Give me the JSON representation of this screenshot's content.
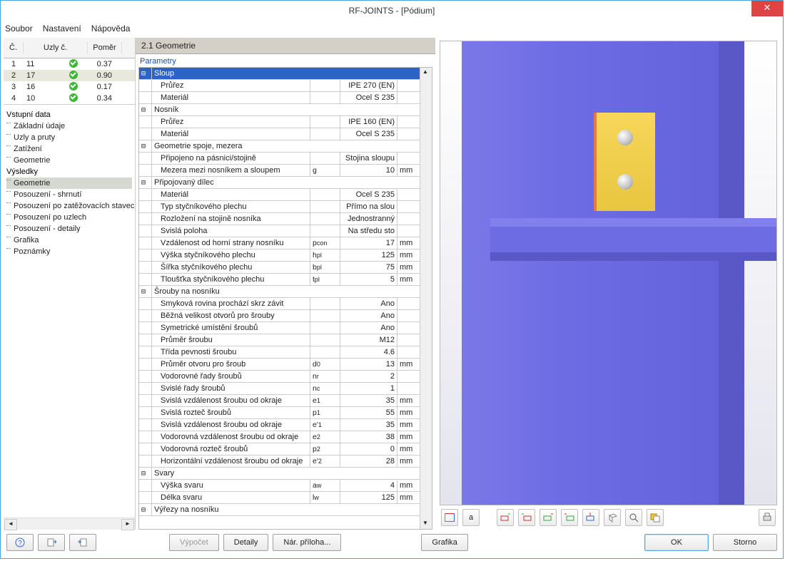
{
  "title": "RF-JOINTS - [Pódium]",
  "menus": [
    "Soubor",
    "Nastavení",
    "Nápověda"
  ],
  "nodelist": {
    "headers": [
      "Č.",
      "Uzly č.",
      "Poměr"
    ],
    "rows": [
      {
        "idx": "1",
        "node": "11",
        "ratio": "0.37",
        "sel": false
      },
      {
        "idx": "2",
        "node": "17",
        "ratio": "0.90",
        "sel": true
      },
      {
        "idx": "3",
        "node": "16",
        "ratio": "0.17",
        "sel": false
      },
      {
        "idx": "4",
        "node": "10",
        "ratio": "0.34",
        "sel": false
      }
    ]
  },
  "tree": {
    "input_hdr": "Vstupní data",
    "input": [
      "Základní údaje",
      "Uzly a pruty",
      "Zatížení",
      "Geometrie"
    ],
    "results_hdr": "Výsledky",
    "results": [
      "Geometrie",
      "Posouzení - shrnutí",
      "Posouzení po zatěžovacích stavech",
      "Posouzení po uzlech",
      "Posouzení - detaily",
      "Grafika",
      "Poznámky"
    ]
  },
  "section": {
    "title": "2.1 Geometrie",
    "param_label": "Parametry"
  },
  "params": [
    {
      "type": "group",
      "label": "Sloup",
      "sel": true
    },
    {
      "type": "row",
      "label": "Průřez",
      "sym": "",
      "val": "IPE 270 (EN)",
      "unit": ""
    },
    {
      "type": "row",
      "label": "Materiál",
      "sym": "",
      "val": "Ocel S 235",
      "unit": ""
    },
    {
      "type": "group",
      "label": "Nosník"
    },
    {
      "type": "row",
      "label": "Průřez",
      "sym": "",
      "val": "IPE 160 (EN)",
      "unit": ""
    },
    {
      "type": "row",
      "label": "Materiál",
      "sym": "",
      "val": "Ocel S 235",
      "unit": ""
    },
    {
      "type": "group",
      "label": "Geometrie spoje, mezera"
    },
    {
      "type": "row",
      "label": "Připojeno na pásnici/stojině",
      "sym": "",
      "val": "Stojina sloupu",
      "unit": ""
    },
    {
      "type": "row",
      "label": "Mezera mezi nosníkem a sloupem",
      "sym": "g",
      "val": "10",
      "unit": "mm"
    },
    {
      "type": "group",
      "label": "Připojovaný dílec"
    },
    {
      "type": "row",
      "label": "Materiál",
      "sym": "",
      "val": "Ocel S 235",
      "unit": ""
    },
    {
      "type": "row",
      "label": "Typ styčníkového plechu",
      "sym": "",
      "val": "Přímo na slou",
      "unit": ""
    },
    {
      "type": "row",
      "label": "Rozložení na stojině nosníka",
      "sym": "",
      "val": "Jednostranný",
      "unit": ""
    },
    {
      "type": "row",
      "label": "Svislá poloha",
      "sym": "",
      "val": "Na středu sto",
      "unit": ""
    },
    {
      "type": "row",
      "label": "Vzdálenost od horní strany nosníku",
      "sym": "p con",
      "val": "17",
      "unit": "mm"
    },
    {
      "type": "row",
      "label": "Výška styčníkového plechu",
      "sym": "h pl",
      "val": "125",
      "unit": "mm"
    },
    {
      "type": "row",
      "label": "Šířka styčníkového plechu",
      "sym": "b pl",
      "val": "75",
      "unit": "mm"
    },
    {
      "type": "row",
      "label": "Tloušťka styčníkového plechu",
      "sym": "t pl",
      "val": "5",
      "unit": "mm"
    },
    {
      "type": "group",
      "label": "Šrouby na nosníku"
    },
    {
      "type": "row",
      "label": "Smyková rovina prochází skrz závit",
      "sym": "",
      "val": "Ano",
      "unit": ""
    },
    {
      "type": "row",
      "label": "Běžná velikost otvorů pro šrouby",
      "sym": "",
      "val": "Ano",
      "unit": ""
    },
    {
      "type": "row",
      "label": "Symetrické umístění šroubů",
      "sym": "",
      "val": "Ano",
      "unit": ""
    },
    {
      "type": "row",
      "label": "Průměr šroubu",
      "sym": "",
      "val": "M12",
      "unit": ""
    },
    {
      "type": "row",
      "label": "Třída pevnosti šroubu",
      "sym": "",
      "val": "4.6",
      "unit": ""
    },
    {
      "type": "row",
      "label": "Průměr otvoru pro šroub",
      "sym": "d 0",
      "val": "13",
      "unit": "mm"
    },
    {
      "type": "row",
      "label": "Vodorovné řady šroubů",
      "sym": "n r",
      "val": "2",
      "unit": ""
    },
    {
      "type": "row",
      "label": "Svislé řady šroubů",
      "sym": "n c",
      "val": "1",
      "unit": ""
    },
    {
      "type": "row",
      "label": "Svislá vzdálenost šroubu od okraje",
      "sym": "e 1",
      "val": "35",
      "unit": "mm"
    },
    {
      "type": "row",
      "label": "Svislá rozteč šroubů",
      "sym": "p 1",
      "val": "55",
      "unit": "mm"
    },
    {
      "type": "row",
      "label": "Svislá vzdálenost šroubu od okraje",
      "sym": "e' 1",
      "val": "35",
      "unit": "mm"
    },
    {
      "type": "row",
      "label": "Vodorovná vzdálenost šroubu od okraje",
      "sym": "e 2",
      "val": "38",
      "unit": "mm"
    },
    {
      "type": "row",
      "label": "Vodorovná rozteč šroubů",
      "sym": "p 2",
      "val": "0",
      "unit": "mm"
    },
    {
      "type": "row",
      "label": "Horizontální vzdálenost šroubu od okraje",
      "sym": "e' 2",
      "val": "28",
      "unit": "mm"
    },
    {
      "type": "group",
      "label": "Svary"
    },
    {
      "type": "row",
      "label": "Výška svaru",
      "sym": "a w",
      "val": "4",
      "unit": "mm"
    },
    {
      "type": "row",
      "label": "Délka svaru",
      "sym": "l w",
      "val": "125",
      "unit": "mm"
    },
    {
      "type": "group",
      "label": "Výřezy na nosníku"
    }
  ],
  "view_tools": [
    "axes-icon",
    "dim-icon",
    "sep",
    "view-x-icon",
    "view-nx-icon",
    "view-y-icon",
    "view-ny-icon",
    "view-z-icon",
    "iso-icon",
    "zoom-icon",
    "layers-icon",
    "sep2",
    "print-icon"
  ],
  "footer": {
    "help": "?",
    "calc": "Výpočet",
    "details": "Detaily",
    "annex": "Nár. příloha...",
    "graphics": "Grafika",
    "ok": "OK",
    "cancel": "Storno"
  }
}
